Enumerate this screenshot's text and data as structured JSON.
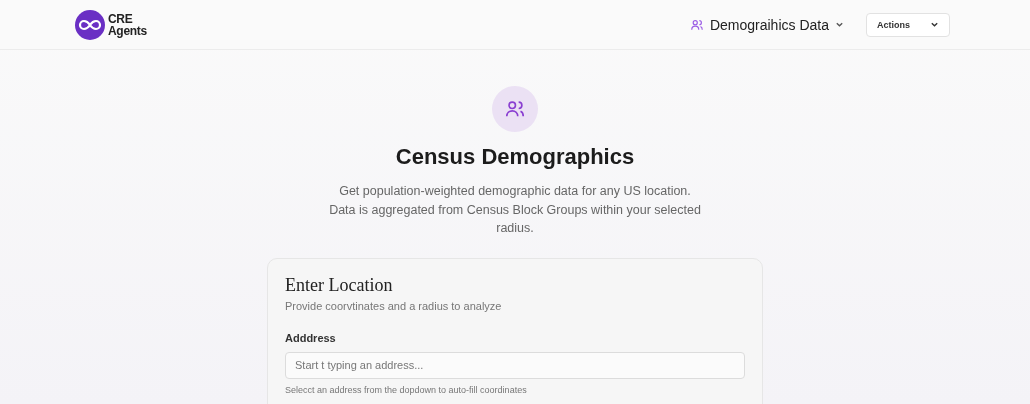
{
  "header": {
    "logo_text": [
      "CRE",
      "Agents"
    ],
    "nav": {
      "label": "Demograihics Data"
    },
    "actions": {
      "label": "Actions"
    }
  },
  "hero": {
    "title": "Census Demographics",
    "description": "Get population-weighted demographic data for any US location. Data is aggregated from Census Block Groups within your selected radius."
  },
  "card": {
    "title": "Enter Location",
    "subtitle": "Provide coorvtinates and a radius to analyze",
    "field": {
      "label": "Adddress",
      "placeholder": "Start t typing an address...",
      "hint": "Selecct an address from the dopdown to auto-fill coordinates"
    }
  }
}
